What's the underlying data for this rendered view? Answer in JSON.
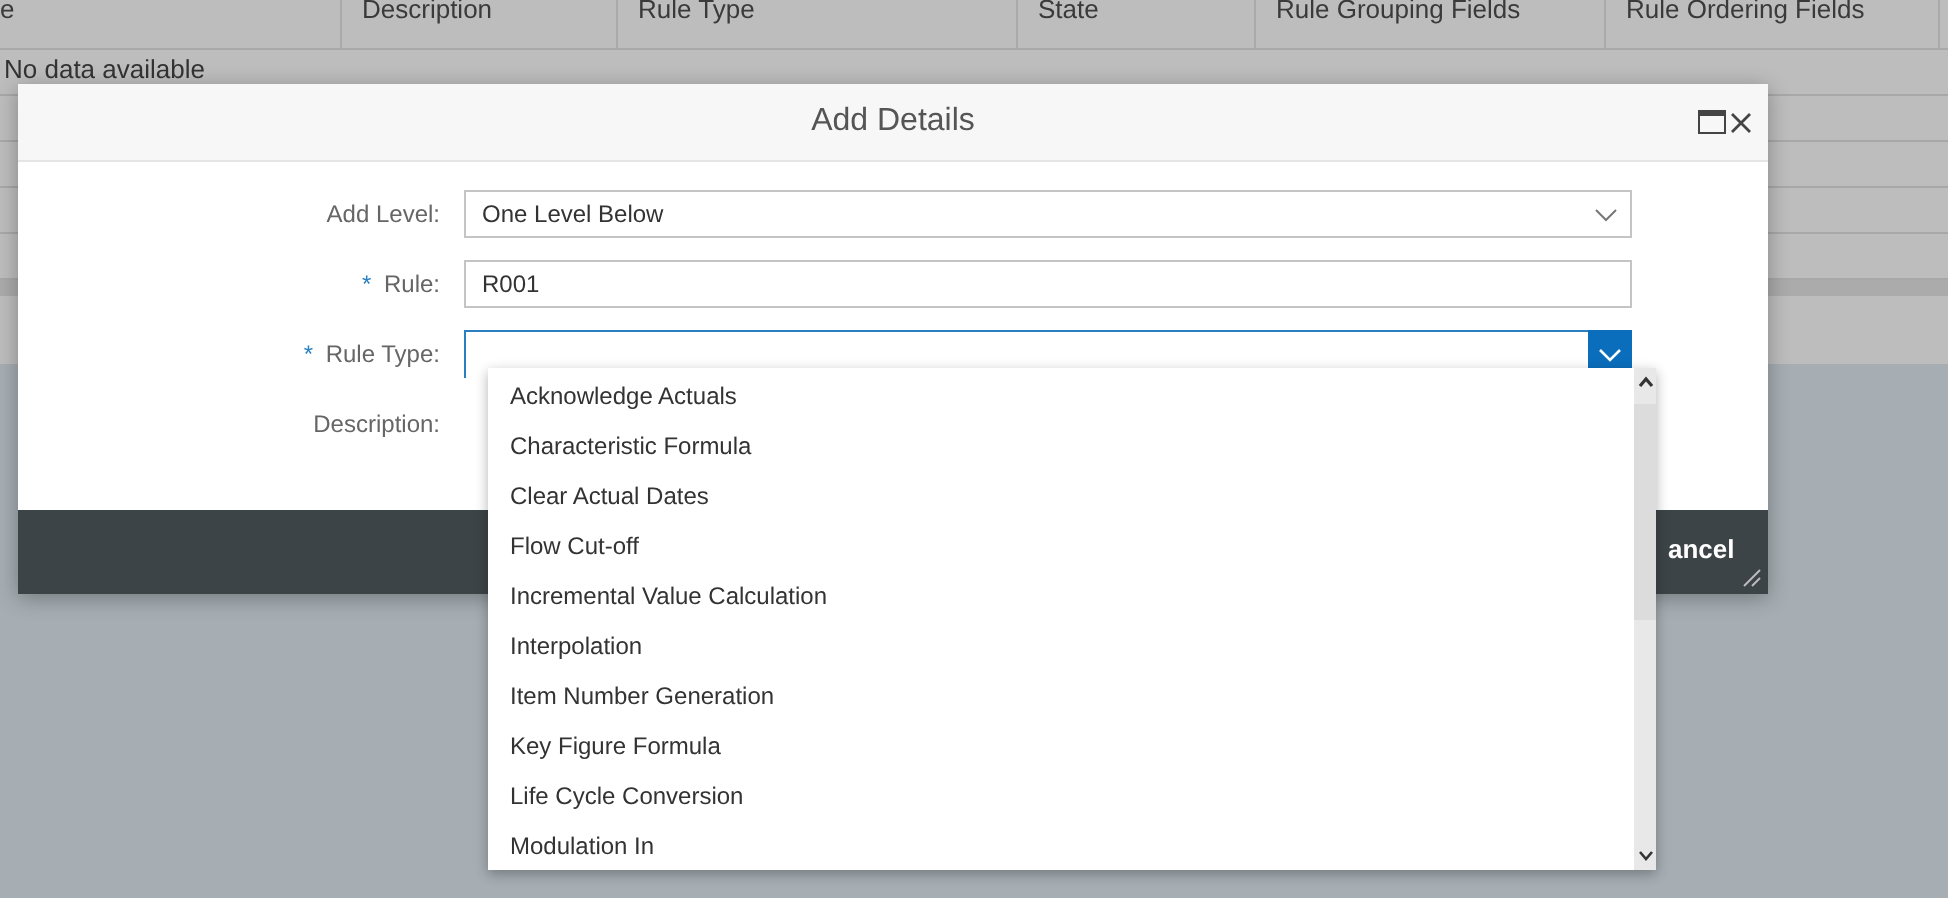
{
  "background_table": {
    "columns": [
      "e",
      "Description",
      "Rule Type",
      "State",
      "Rule Grouping Fields",
      "Rule Ordering Fields"
    ],
    "empty_text": "No data available"
  },
  "dialog": {
    "title": "Add Details",
    "fields": [
      {
        "label": "Add Level:",
        "kind": "select",
        "value": "One Level Below",
        "focused": false
      },
      {
        "label": "Rule:",
        "required_mark": "*",
        "kind": "input",
        "value": "R001",
        "focused": false
      },
      {
        "label": "Rule Type:",
        "required_mark": "*",
        "kind": "select",
        "focused": true
      },
      {
        "label": "Description:",
        "kind": "hidden"
      }
    ],
    "footer_button": "ancel"
  },
  "dropdown": {
    "items": [
      {
        "label": "Acknowledge Actuals"
      },
      {
        "label": "Characteristic Formula"
      },
      {
        "label": "Clear Actual Dates"
      },
      {
        "label": "Flow Cut-off"
      },
      {
        "label": "Incremental Value Calculation"
      },
      {
        "label": "Interpolation"
      },
      {
        "label": "Item Number Generation"
      },
      {
        "label": "Key Figure Formula"
      },
      {
        "label": "Life Cycle Conversion"
      },
      {
        "label": "Modulation In"
      }
    ]
  }
}
